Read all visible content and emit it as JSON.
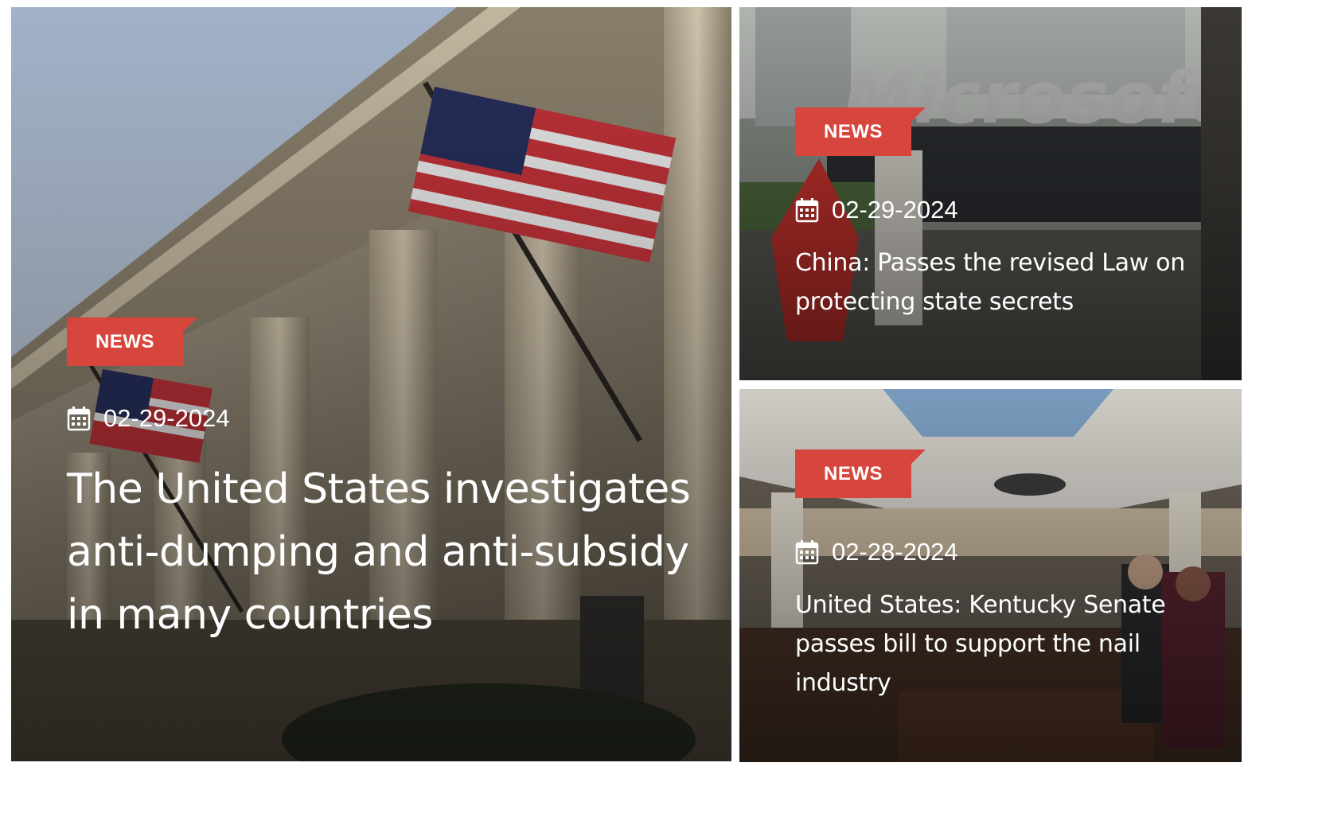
{
  "articles": {
    "featured": {
      "category": "NEWS",
      "date": "02-29-2024",
      "title": "The United States investigates anti-dumping and anti-subsidy in many countries",
      "image": "government-building-with-us-flag"
    },
    "top_right": {
      "category": "NEWS",
      "date": "02-29-2024",
      "title": "China: Passes the revised Law on protecting state secrets",
      "image": "microsoft-building-sign"
    },
    "bottom_right": {
      "category": "NEWS",
      "date": "02-28-2024",
      "title": "United States: Kentucky Senate passes bill to support the nail industry",
      "image": "senate-chamber-interior"
    }
  },
  "colors": {
    "badge": "#d7463d",
    "text": "#ffffff"
  },
  "icons": {
    "date": "calendar-icon"
  }
}
